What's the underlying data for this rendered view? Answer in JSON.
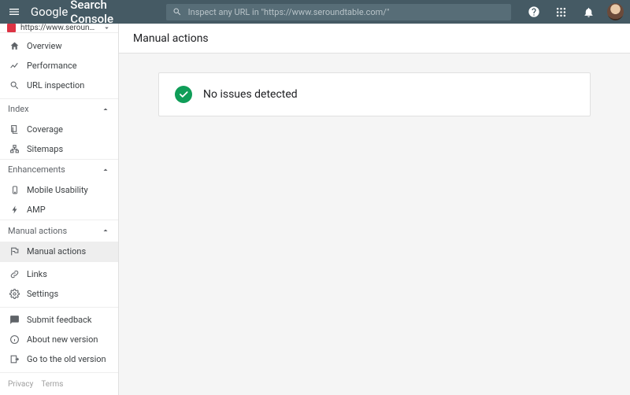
{
  "header": {
    "logo_light": "Google",
    "logo_bold": "Search Console",
    "search_placeholder": "Inspect any URL in \"https://www.seroundtable.com/\""
  },
  "sidebar": {
    "property_label": "https://www.seroundtable.co...",
    "top_items": [
      {
        "label": "Overview",
        "icon": "home"
      },
      {
        "label": "Performance",
        "icon": "chart"
      },
      {
        "label": "URL inspection",
        "icon": "search"
      }
    ],
    "sections": [
      {
        "heading": "Index",
        "items": [
          {
            "label": "Coverage",
            "icon": "pages"
          },
          {
            "label": "Sitemaps",
            "icon": "sitemap"
          }
        ]
      },
      {
        "heading": "Enhancements",
        "items": [
          {
            "label": "Mobile Usability",
            "icon": "mobile"
          },
          {
            "label": "AMP",
            "icon": "amp"
          }
        ]
      },
      {
        "heading": "Manual actions",
        "items": [
          {
            "label": "Manual actions",
            "icon": "flag",
            "active": true
          }
        ]
      }
    ],
    "bottom_items": [
      {
        "label": "Links",
        "icon": "links"
      },
      {
        "label": "Settings",
        "icon": "settings"
      }
    ],
    "extra_items": [
      {
        "label": "Submit feedback",
        "icon": "feedback"
      },
      {
        "label": "About new version",
        "icon": "info"
      },
      {
        "label": "Go to the old version",
        "icon": "exit"
      }
    ],
    "footer": {
      "privacy": "Privacy",
      "terms": "Terms"
    }
  },
  "page": {
    "title": "Manual actions",
    "status_text": "No issues detected"
  }
}
